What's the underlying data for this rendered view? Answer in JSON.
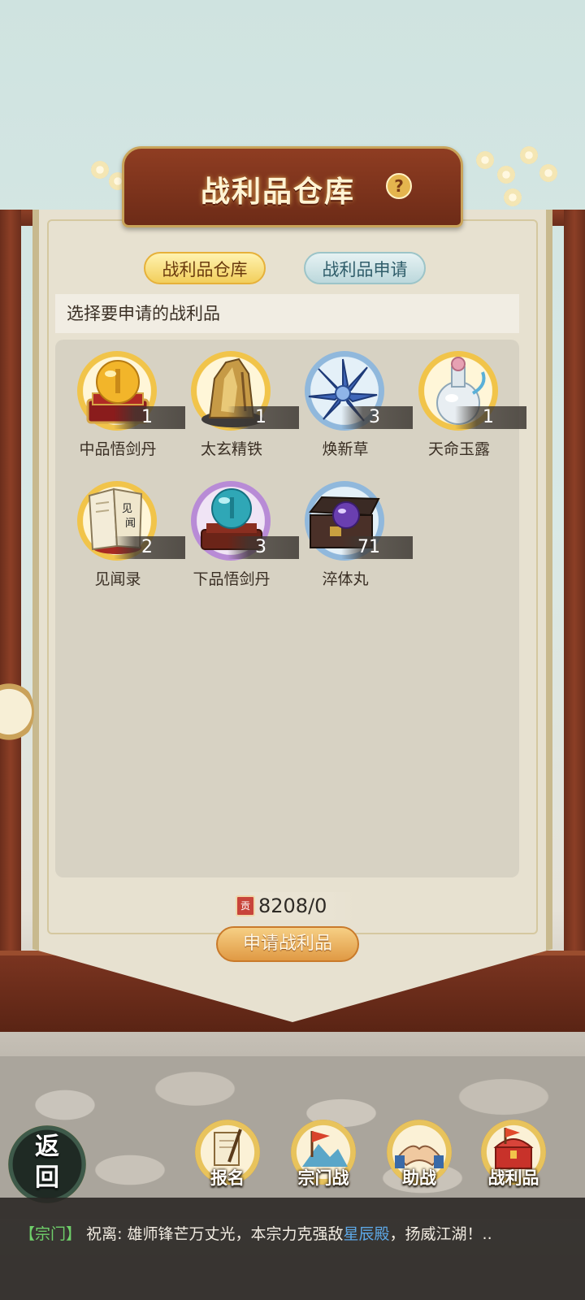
{
  "title": "战利品仓库",
  "help_label": "?",
  "tabs": [
    {
      "label": "战利品仓库",
      "active": true
    },
    {
      "label": "战利品申请",
      "active": false
    }
  ],
  "prompt": "选择要申请的战利品",
  "items": [
    {
      "name": "中品悟剑丹",
      "count": "1",
      "icon": "golden-orb-on-stand-icon"
    },
    {
      "name": "太玄精铁",
      "count": "1",
      "icon": "iron-ore-icon"
    },
    {
      "name": "焕新草",
      "count": "3",
      "icon": "blue-flower-icon"
    },
    {
      "name": "天命玉露",
      "count": "1",
      "icon": "jade-bottle-icon"
    },
    {
      "name": "见闻录",
      "count": "2",
      "icon": "book-icon"
    },
    {
      "name": "下品悟剑丹",
      "count": "3",
      "icon": "teal-orb-on-stand-icon"
    },
    {
      "name": "淬体丸",
      "count": "71",
      "icon": "purple-pill-chest-icon"
    }
  ],
  "points": {
    "icon_char": "贡",
    "value": "8208/0"
  },
  "apply_button": "申请战利品",
  "nav": {
    "return_label": "返回",
    "buttons": [
      {
        "label": "报名",
        "icon": "scroll-brush-icon"
      },
      {
        "label": "宗门战",
        "icon": "flag-mountain-icon"
      },
      {
        "label": "助战",
        "icon": "handshake-icon"
      },
      {
        "label": "战利品",
        "icon": "treasure-chest-icon"
      }
    ]
  },
  "chat": {
    "channel": "【宗门】",
    "speaker": "祝离:",
    "text_before": "雄师锋芒万丈光，本宗力克强敌",
    "highlight": "星辰殿",
    "text_after": "，扬威江湖！..",
    "highlight_color": "#5da8e6"
  },
  "colors": {
    "tab_active": "#f2cf5c",
    "tab_inactive": "#bcd8dc",
    "frame": "#6b2e1c",
    "chat_channel": "#6fd06a"
  }
}
